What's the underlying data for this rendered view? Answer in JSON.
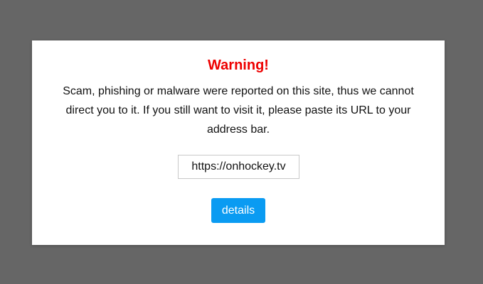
{
  "dialog": {
    "title": "Warning!",
    "message": "Scam, phishing or malware were reported on this site, thus we cannot direct you to it. If you still want to visit it, please paste its URL to your address bar.",
    "url_value": "https://onhockey.tv",
    "details_label": "details"
  },
  "colors": {
    "background": "#666666",
    "dialog_background": "#ffffff",
    "title": "#ee0000",
    "button": "#0a9bf2",
    "button_text": "#ffffff"
  }
}
